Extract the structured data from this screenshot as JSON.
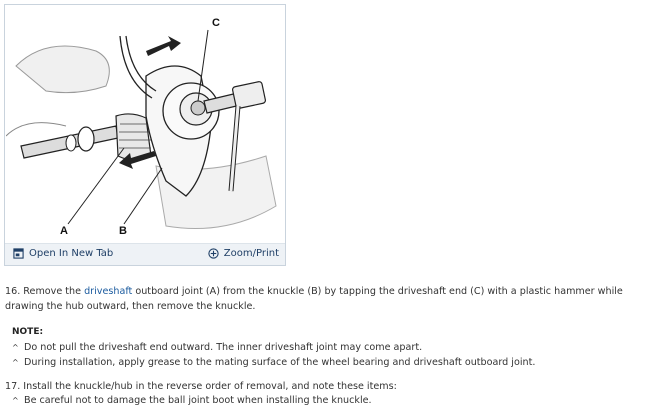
{
  "figure": {
    "callouts": [
      "C",
      "A",
      "B"
    ],
    "open_tab_label": "Open In New Tab",
    "zoom_label": "Zoom/Print",
    "open_tab_icon": "open-in-new-tab-icon",
    "zoom_icon": "zoom-plus-icon"
  },
  "step16": {
    "prefix": "16. Remove the ",
    "link": "driveshaft",
    "rest": " outboard joint (A) from the knuckle (B) by tapping the driveshaft end (C) with a plastic hammer while drawing the hub outward, then remove the knuckle."
  },
  "note": {
    "title": "NOTE:",
    "items": [
      "Do not pull the driveshaft end outward. The inner driveshaft joint may come apart.",
      "During installation, apply grease to the mating surface of the wheel bearing and driveshaft outboard joint."
    ]
  },
  "step17": {
    "text": "17. Install the knuckle/hub in the reverse order of removal, and note these items:",
    "items": [
      "Be careful not to damage the ball joint boot when installing the knuckle."
    ]
  },
  "bullet_glyph": "^"
}
